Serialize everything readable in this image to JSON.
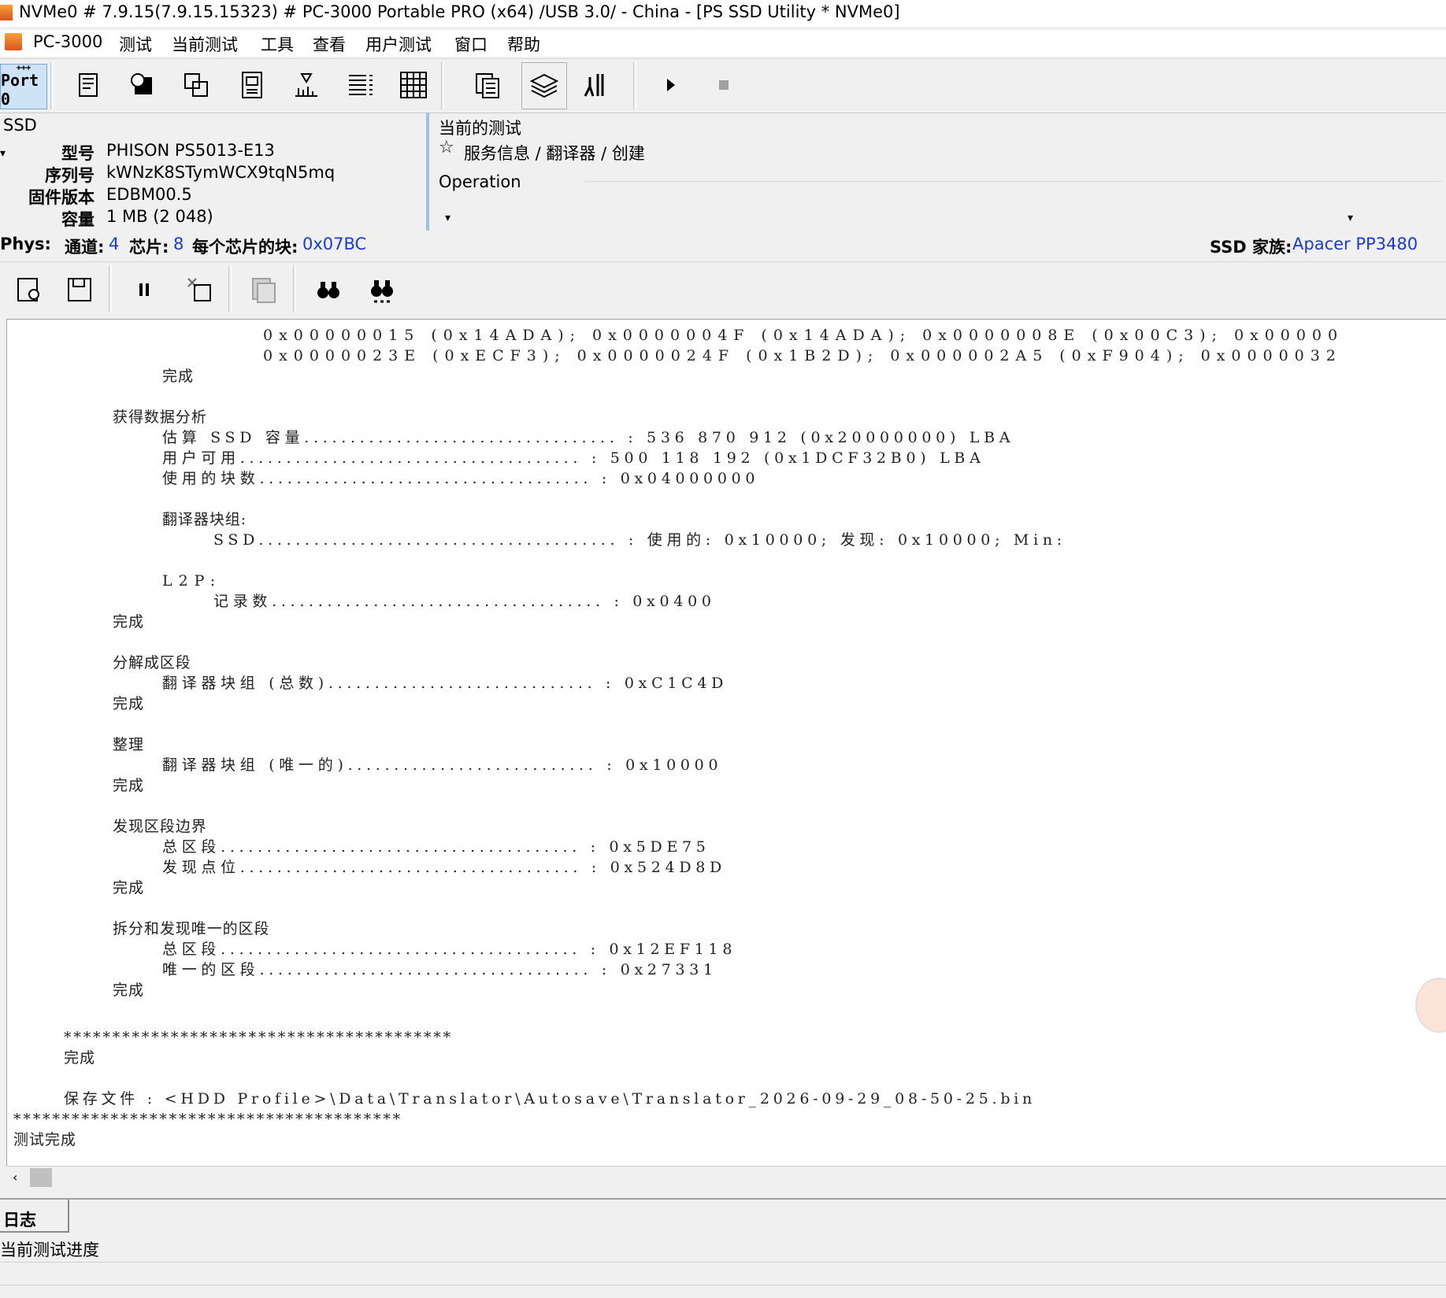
{
  "window": {
    "title": "NVMe0 # 7.9.15(7.9.15.15323) # PC-3000 Portable PRO (x64) /USB 3.0/ - China - [PS SSD Utility * NVMe0]"
  },
  "menu": [
    "PC-3000",
    "测试",
    "当前测试",
    "工具",
    "查看",
    "用户测试",
    "窗口",
    "帮助"
  ],
  "toolbar": {
    "port_label": "Port 0"
  },
  "device": {
    "section": "SSD",
    "model_label": "型号",
    "model": "PHISON PS5013-E13",
    "serial_label": "序列号",
    "serial": "kWNzK8STymWCX9tqN5mq",
    "firmware_label": "固件版本",
    "firmware": "EDBM00.5",
    "capacity_label": "容量",
    "capacity": "1 MB (2 048)"
  },
  "current_test": {
    "header": "当前的测试",
    "path": "服务信息 / 翻译器 / 创建",
    "operation": "Operation"
  },
  "phys": {
    "label": "Phys:",
    "channels_label": "通道:",
    "channels": "4",
    "chips_label": "芯片:",
    "chips": "8",
    "blocks_label": "每个芯片的块:",
    "blocks": "0x07BC",
    "family_label": "SSD 家族:",
    "family": "Apacer PP3480"
  },
  "log_lines": [
    "0x00000015 (0x14ADA); 0x0000004F (0x14ADA); 0x0000008E (0x00C3); 0x00000",
    "0x0000023E (0xECF3); 0x0000024F (0x1B2D); 0x000002A5 (0xF904); 0x0000032",
    "完成",
    "获得数据分析",
    "估算 SSD 容量.................................. : 536 870 912 (0x20000000) LBA",
    "用户可用..................................... : 500 118 192 (0x1DCF32B0) LBA",
    "使用的块数.................................... : 0x04000000",
    "翻译器块组:",
    "SSD....................................... : 使用的: 0x10000; 发现: 0x10000; Min:",
    "L2P:",
    "记录数.................................... : 0x0400",
    "完成",
    "分解成区段",
    "翻译器块组 (总数)............................. : 0xC1C4D",
    "完成",
    "整理",
    "翻译器块组 (唯一的)........................... : 0x10000",
    "完成",
    "发现区段边界",
    "总区段....................................... : 0x5DE75",
    "发现点位..................................... : 0x524D8D",
    "完成",
    "拆分和发现唯一的区段",
    "总区段....................................... : 0x12EF118",
    "唯一的区段.................................... : 0x27331",
    "完成",
    "****************************************",
    "完成",
    "保存文件 : <HDD Profile>\\Data\\Translator\\Autosave\\Translator_2026-09-29_08-50-25.bin",
    "****************************************",
    "测试完成"
  ],
  "bottom": {
    "tab_log": "日志",
    "progress_label": "当前测试进度"
  }
}
